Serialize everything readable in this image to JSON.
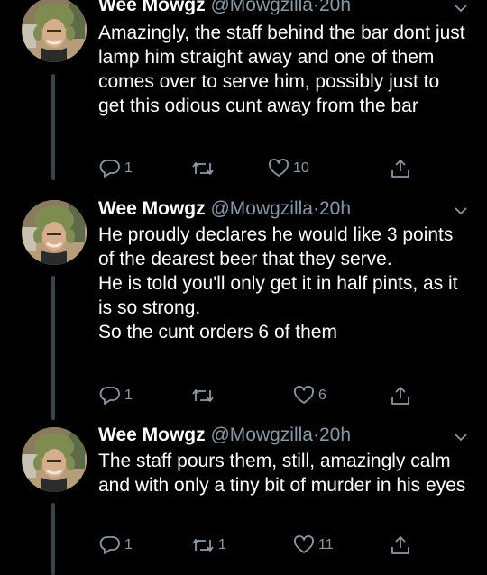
{
  "tweets": [
    {
      "name": "Wee Mowgz",
      "handle": "@Mowgzilla",
      "dot": "·",
      "time": "20h",
      "text": "Amazingly, the staff behind the bar dont just lamp him straight away and one of them comes over to serve him, possibly just to get this odious cunt away from the bar",
      "replies": "1",
      "retweets": "",
      "likes": "10"
    },
    {
      "name": "Wee Mowgz",
      "handle": "@Mowgzilla",
      "dot": "·",
      "time": "20h",
      "text": "He proudly declares he would like 3 points of the dearest beer that they serve.\nHe is told you'll only get it in half pints, as it is so strong.\nSo the cunt orders 6 of them",
      "replies": "1",
      "retweets": "",
      "likes": "6"
    },
    {
      "name": "Wee Mowgz",
      "handle": "@Mowgzilla",
      "dot": "·",
      "time": "20h",
      "text": "The staff pours them, still, amazingly calm and with only a tiny bit of murder in his eyes",
      "replies": "1",
      "retweets": "1",
      "likes": "11"
    }
  ],
  "icons": {
    "reply": "reply-icon",
    "retweet": "retweet-icon",
    "like": "heart-icon",
    "share": "share-icon",
    "caret": "chevron-down-icon"
  },
  "colors": {
    "background": "#000000",
    "text": "#ffffff",
    "secondary": "#8899a6",
    "thread_line": "#38444d"
  }
}
